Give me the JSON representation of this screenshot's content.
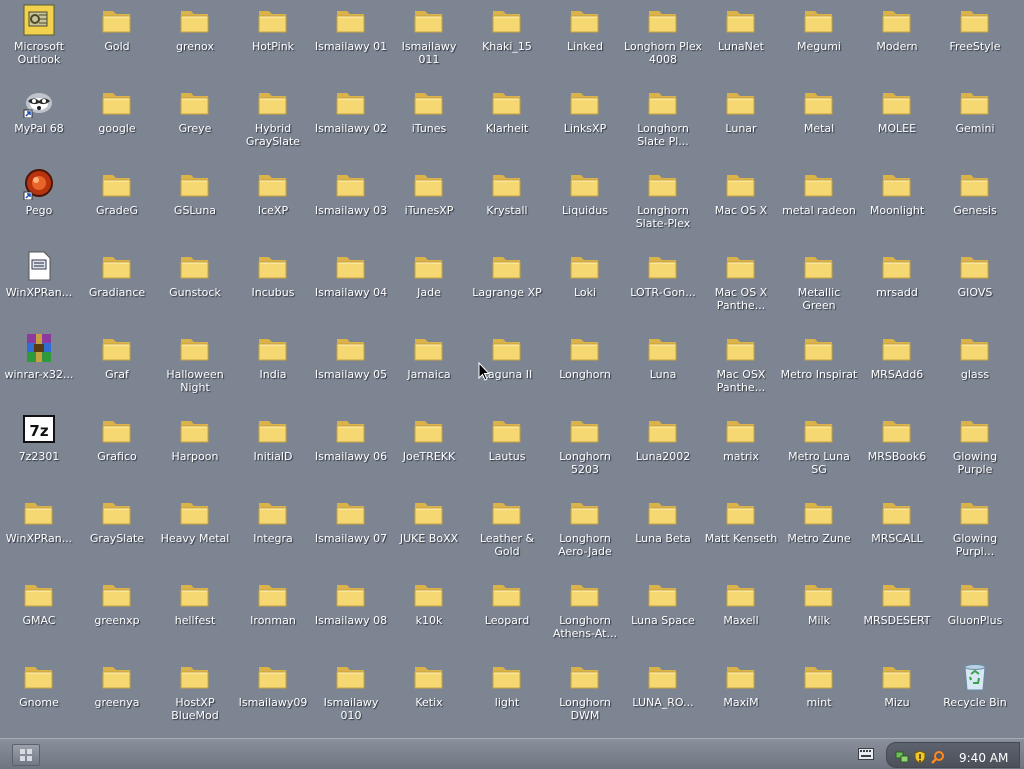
{
  "colors": {
    "desktop": "#7d8593",
    "folder": "#f3d46a",
    "taskbar": "#7b818c"
  },
  "desktop_icons": [
    {
      "label": "Microsoft Outlook",
      "icon": "outlook-icon"
    },
    {
      "label": "Gold",
      "icon": "folder-icon"
    },
    {
      "label": "grenox",
      "icon": "folder-icon"
    },
    {
      "label": "HotPink",
      "icon": "folder-icon"
    },
    {
      "label": "Ismailawy 01",
      "icon": "folder-icon"
    },
    {
      "label": "Ismailawy 011",
      "icon": "folder-icon"
    },
    {
      "label": "Khaki_15",
      "icon": "folder-icon"
    },
    {
      "label": "Linked",
      "icon": "folder-icon"
    },
    {
      "label": "Longhorn Plex 4008",
      "icon": "folder-icon"
    },
    {
      "label": "LunaNet",
      "icon": "folder-icon"
    },
    {
      "label": "Megumi",
      "icon": "folder-icon"
    },
    {
      "label": "Modern",
      "icon": "folder-icon"
    },
    {
      "label": "FreeStyle",
      "icon": "folder-icon"
    },
    {
      "label": "MyPal 68",
      "icon": "mypal-icon"
    },
    {
      "label": "google",
      "icon": "folder-icon"
    },
    {
      "label": "Greye",
      "icon": "folder-icon"
    },
    {
      "label": "Hybrid GraySlate",
      "icon": "folder-icon"
    },
    {
      "label": "Ismailawy 02",
      "icon": "folder-icon"
    },
    {
      "label": "iTunes",
      "icon": "folder-icon"
    },
    {
      "label": "Klarheit",
      "icon": "folder-icon"
    },
    {
      "label": "LinksXP",
      "icon": "folder-icon"
    },
    {
      "label": "Longhorn Slate Pl...",
      "icon": "folder-icon"
    },
    {
      "label": "Lunar",
      "icon": "folder-icon"
    },
    {
      "label": "Metal",
      "icon": "folder-icon"
    },
    {
      "label": "MOLEE",
      "icon": "folder-icon"
    },
    {
      "label": "Gemini",
      "icon": "folder-icon"
    },
    {
      "label": "Pego",
      "icon": "pego-icon"
    },
    {
      "label": "GradeG",
      "icon": "folder-icon"
    },
    {
      "label": "GSLuna",
      "icon": "folder-icon"
    },
    {
      "label": "IceXP",
      "icon": "folder-icon"
    },
    {
      "label": "Ismailawy 03",
      "icon": "folder-icon"
    },
    {
      "label": "iTunesXP",
      "icon": "folder-icon"
    },
    {
      "label": "Krystall",
      "icon": "folder-icon"
    },
    {
      "label": "Liquidus",
      "icon": "folder-icon"
    },
    {
      "label": "Longhorn Slate-Plex",
      "icon": "folder-icon"
    },
    {
      "label": "Mac OS X",
      "icon": "folder-icon"
    },
    {
      "label": "metal radeon",
      "icon": "folder-icon"
    },
    {
      "label": "Moonlight",
      "icon": "folder-icon"
    },
    {
      "label": "Genesis",
      "icon": "folder-icon"
    },
    {
      "label": "WinXPRan...",
      "icon": "document-icon"
    },
    {
      "label": "Gradiance",
      "icon": "folder-icon"
    },
    {
      "label": "Gunstock",
      "icon": "folder-icon"
    },
    {
      "label": "Incubus",
      "icon": "folder-icon"
    },
    {
      "label": "Ismailawy 04",
      "icon": "folder-icon"
    },
    {
      "label": "Jade",
      "icon": "folder-icon"
    },
    {
      "label": "Lagrange XP",
      "icon": "folder-icon"
    },
    {
      "label": "Loki",
      "icon": "folder-icon"
    },
    {
      "label": "LOTR-Gon...",
      "icon": "folder-icon"
    },
    {
      "label": "Mac OS X Panthe...",
      "icon": "folder-icon"
    },
    {
      "label": "Metallic Green",
      "icon": "folder-icon"
    },
    {
      "label": "mrsadd",
      "icon": "folder-icon"
    },
    {
      "label": "GIOVS",
      "icon": "folder-icon"
    },
    {
      "label": "winrar-x32...",
      "icon": "winrar-icon"
    },
    {
      "label": "Graf",
      "icon": "folder-icon"
    },
    {
      "label": "Halloween Night",
      "icon": "folder-icon"
    },
    {
      "label": "India",
      "icon": "folder-icon"
    },
    {
      "label": "Ismailawy 05",
      "icon": "folder-icon"
    },
    {
      "label": "Jamaica",
      "icon": "folder-icon"
    },
    {
      "label": "Laguna II",
      "icon": "folder-icon"
    },
    {
      "label": "Longhorn",
      "icon": "folder-icon"
    },
    {
      "label": "Luna",
      "icon": "folder-icon"
    },
    {
      "label": "Mac OSX Panthe...",
      "icon": "folder-icon"
    },
    {
      "label": "Metro Inspirat",
      "icon": "folder-icon"
    },
    {
      "label": "MRSAdd6",
      "icon": "folder-icon"
    },
    {
      "label": "glass",
      "icon": "folder-icon"
    },
    {
      "label": "7z2301",
      "icon": "7zip-icon"
    },
    {
      "label": "Grafico",
      "icon": "folder-icon"
    },
    {
      "label": "Harpoon",
      "icon": "folder-icon"
    },
    {
      "label": "InitialD",
      "icon": "folder-icon"
    },
    {
      "label": "Ismailawy 06",
      "icon": "folder-icon"
    },
    {
      "label": "JoeTREKK",
      "icon": "folder-icon"
    },
    {
      "label": "Lautus",
      "icon": "folder-icon"
    },
    {
      "label": "Longhorn 5203",
      "icon": "folder-icon"
    },
    {
      "label": "Luna2002",
      "icon": "folder-icon"
    },
    {
      "label": "matrix",
      "icon": "folder-icon"
    },
    {
      "label": "Metro Luna SG",
      "icon": "folder-icon"
    },
    {
      "label": "MRSBook6",
      "icon": "folder-icon"
    },
    {
      "label": "Glowing Purple",
      "icon": "folder-icon"
    },
    {
      "label": "WinXPRan...",
      "icon": "folder-icon"
    },
    {
      "label": "GraySlate",
      "icon": "folder-icon"
    },
    {
      "label": "Heavy Metal",
      "icon": "folder-icon"
    },
    {
      "label": "Integra",
      "icon": "folder-icon"
    },
    {
      "label": "Ismailawy 07",
      "icon": "folder-icon"
    },
    {
      "label": "JUKE BoXX",
      "icon": "folder-icon"
    },
    {
      "label": "Leather & Gold",
      "icon": "folder-icon"
    },
    {
      "label": "Longhorn Aero-Jade",
      "icon": "folder-icon"
    },
    {
      "label": "Luna Beta",
      "icon": "folder-icon"
    },
    {
      "label": "Matt Kenseth",
      "icon": "folder-icon"
    },
    {
      "label": "Metro Zune",
      "icon": "folder-icon"
    },
    {
      "label": "MRSCALL",
      "icon": "folder-icon"
    },
    {
      "label": "Glowing Purpl...",
      "icon": "folder-icon"
    },
    {
      "label": "GMAC",
      "icon": "folder-icon"
    },
    {
      "label": "greenxp",
      "icon": "folder-icon"
    },
    {
      "label": "hellfest",
      "icon": "folder-icon"
    },
    {
      "label": "Ironman",
      "icon": "folder-icon"
    },
    {
      "label": "Ismailawy 08",
      "icon": "folder-icon"
    },
    {
      "label": "k10k",
      "icon": "folder-icon"
    },
    {
      "label": "Leopard",
      "icon": "folder-icon"
    },
    {
      "label": "Longhorn Athens-At...",
      "icon": "folder-icon"
    },
    {
      "label": "Luna Space",
      "icon": "folder-icon"
    },
    {
      "label": "Maxell",
      "icon": "folder-icon"
    },
    {
      "label": "Milk",
      "icon": "folder-icon"
    },
    {
      "label": "MRSDESERT",
      "icon": "folder-icon"
    },
    {
      "label": "GluonPlus",
      "icon": "folder-icon"
    },
    {
      "label": "Gnome",
      "icon": "folder-icon"
    },
    {
      "label": "greenya",
      "icon": "folder-icon"
    },
    {
      "label": "HostXP BlueMod",
      "icon": "folder-icon"
    },
    {
      "label": "Ismailawy09",
      "icon": "folder-icon"
    },
    {
      "label": "Ismailawy 010",
      "icon": "folder-icon"
    },
    {
      "label": "Ketix",
      "icon": "folder-icon"
    },
    {
      "label": "light",
      "icon": "folder-icon"
    },
    {
      "label": "Longhorn DWM",
      "icon": "folder-icon"
    },
    {
      "label": "LUNA_RO...",
      "icon": "folder-icon"
    },
    {
      "label": "MaxiM",
      "icon": "folder-icon"
    },
    {
      "label": "mint",
      "icon": "folder-icon"
    },
    {
      "label": "Mizu",
      "icon": "folder-icon"
    },
    {
      "label": "Recycle Bin",
      "icon": "recycle-bin-icon"
    }
  ],
  "taskbar": {
    "start_icon": "start-grid-icon",
    "tray_icons": [
      "keyboard-icon",
      "network-icon",
      "shield-icon",
      "search-icon"
    ],
    "clock": "9:40 AM"
  }
}
